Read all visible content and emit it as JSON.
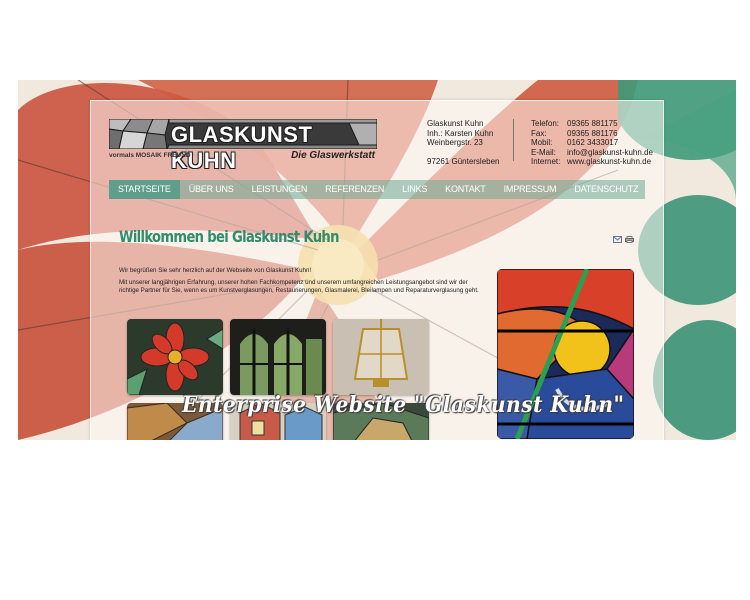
{
  "logo": {
    "brand": "GLASKUNST KUHN",
    "former": "vormals MOSAIK FREUND",
    "subtitle": "Die Glaswerkstatt"
  },
  "address": {
    "lines": [
      "Glaskunst Kuhn",
      "Inh.: Karsten Kuhn",
      "Weinbergstr. 23",
      "",
      "97261 Güntersleben"
    ]
  },
  "contact": {
    "rows": [
      {
        "label": "Telefon:",
        "value": "09365 881175"
      },
      {
        "label": "Fax:",
        "value": "09365 881176"
      },
      {
        "label": "Mobil:",
        "value": "0162 3433017"
      },
      {
        "label": "E-Mail:",
        "value": "info@glaskunst-kuhn.de"
      },
      {
        "label": "Internet:",
        "value": "www.glaskunst-kuhn.de"
      }
    ]
  },
  "nav": {
    "items": [
      "Startseite",
      "Über uns",
      "Leistungen",
      "Referenzen",
      "Links",
      "Kontakt",
      "Impressum",
      "Datenschutz"
    ],
    "active": "Startseite"
  },
  "content": {
    "heading": "Willkommen bei Glaskunst Kuhn",
    "paragraph1": "Wir begrüßen Sie sehr herzlich auf der Webseite von Glaskunst Kuhn!",
    "paragraph2": "Mit unserer langjährigen Erfahrung, unserer hohen Fachkompetenz und unserem umfangreichen Leistungsangebot sind wir der richtige Partner für Sie, wenn es um Kunstverglasungen, Restaurierungen, Glasmalerei, Bleilampen und Reparaturverglasung geht."
  },
  "icons": {
    "mail": "mail-icon",
    "print": "print-icon"
  },
  "caption": "Enterprise Website \"Glaskunst Kuhn\"",
  "colors": {
    "accent_green": "#2f8c6c",
    "nav_active": "#5f9e8a",
    "petal_red": "#c84a35",
    "leaf_green": "#3f9a7a"
  }
}
